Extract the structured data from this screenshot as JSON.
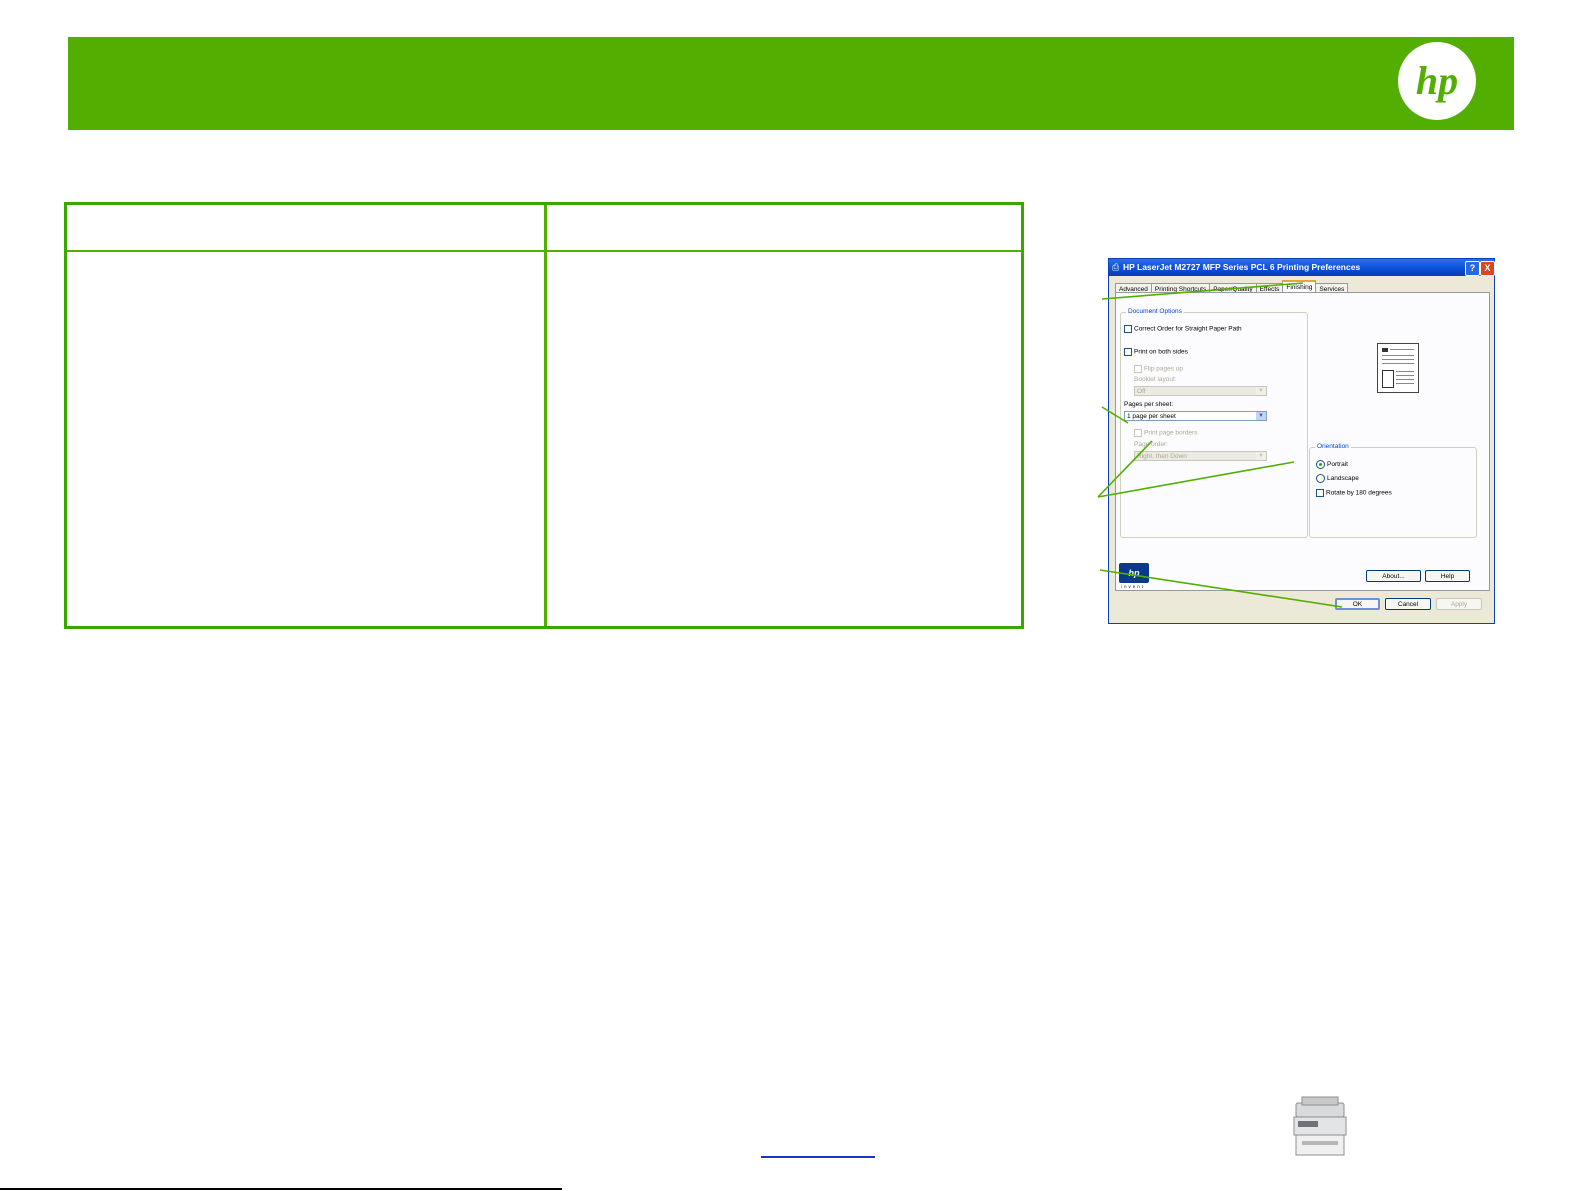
{
  "brand": {
    "logo_text": "hp",
    "banner_color": "#52ae00"
  },
  "dialog": {
    "title": "HP LaserJet M2727 MFP Series PCL 6 Printing Preferences",
    "title_buttons": {
      "help": "?",
      "close": "X"
    },
    "tabs": [
      {
        "label": "Advanced",
        "active": false
      },
      {
        "label": "Printing Shortcuts",
        "active": false
      },
      {
        "label": "Paper/Quality",
        "active": false
      },
      {
        "label": "Effects",
        "active": false
      },
      {
        "label": "Finishing",
        "active": true
      },
      {
        "label": "Services",
        "active": false
      }
    ],
    "document_options": {
      "group_label": "Document Options",
      "correct_order_label": "Correct Order for Straight Paper Path",
      "print_both_sides_label": "Print on both sides",
      "flip_pages_up_label": "Flip pages up",
      "booklet_layout_label": "Booklet layout:",
      "booklet_layout_value": "Off",
      "pages_per_sheet_label": "Pages per sheet:",
      "pages_per_sheet_value": "1 page per sheet",
      "print_page_borders_label": "Print page borders",
      "page_order_label": "Page order:",
      "page_order_value": "Right, then Down"
    },
    "orientation": {
      "group_label": "Orientation",
      "portrait_label": "Portrait",
      "landscape_label": "Landscape",
      "rotate_label": "Rotate by 180 degrees",
      "selected": "Portrait"
    },
    "logo_text": "hp",
    "logo_tagline": "invent",
    "buttons": {
      "about": "About...",
      "help": "Help",
      "ok": "OK",
      "cancel": "Cancel",
      "apply": "Apply"
    }
  }
}
